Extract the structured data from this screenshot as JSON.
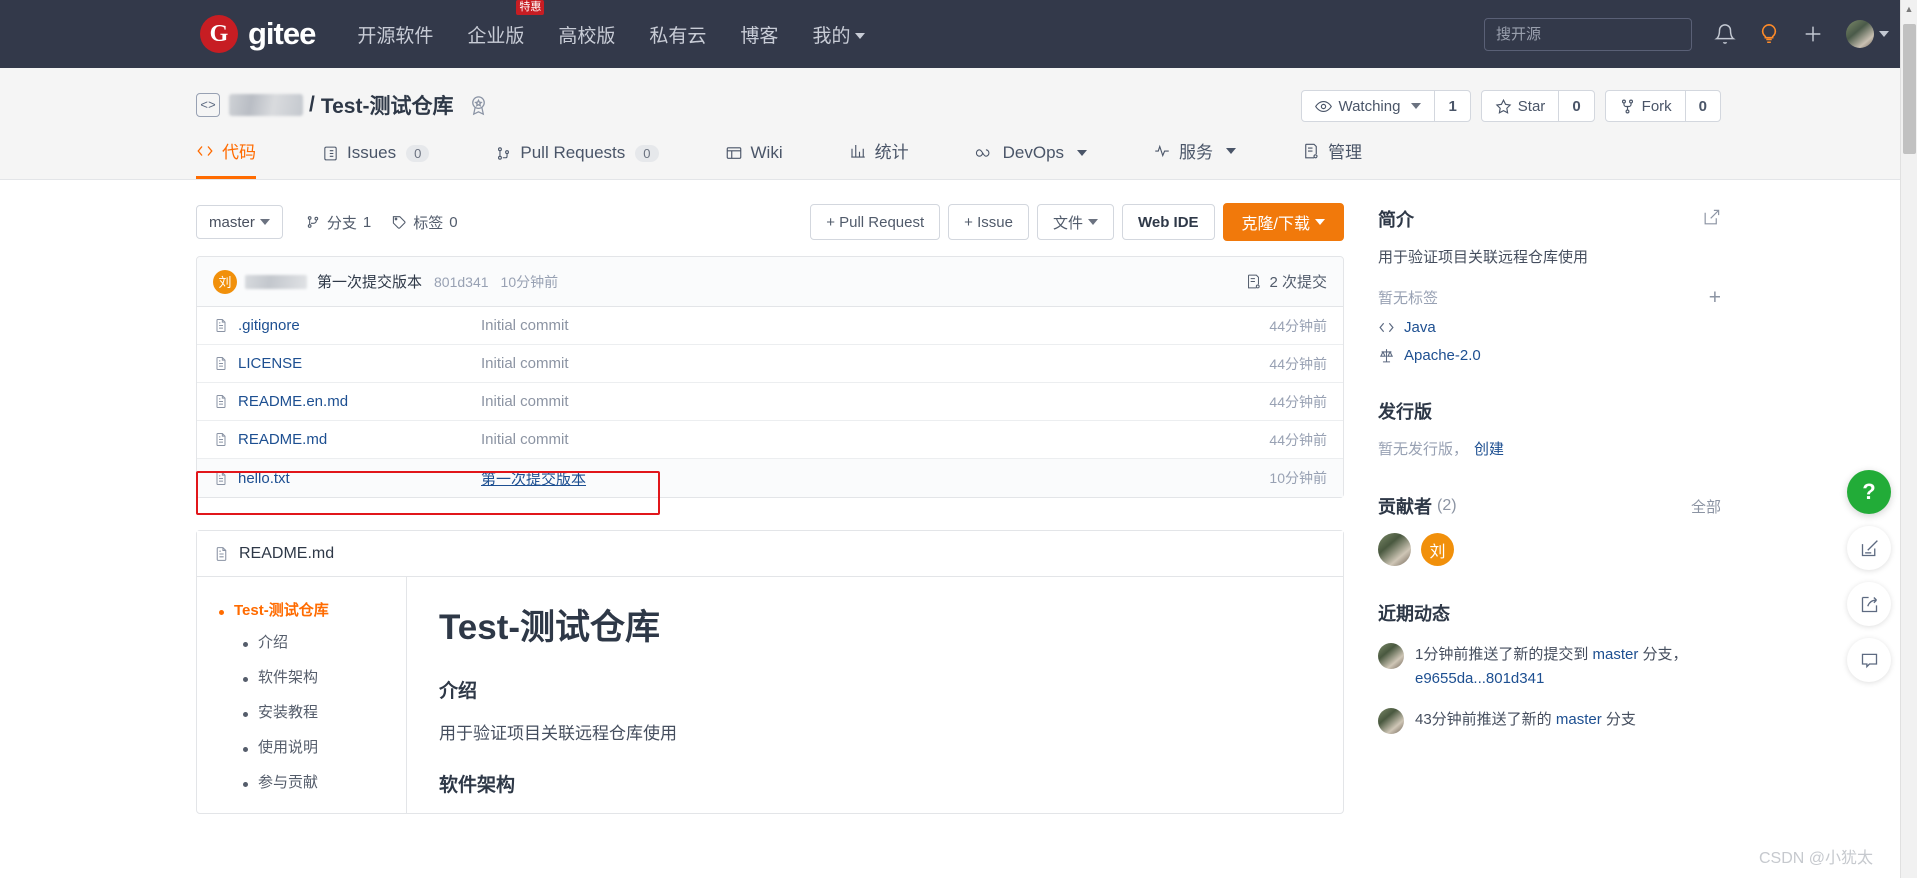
{
  "topnav": {
    "brand": "gitee",
    "logo_letter": "G",
    "links": [
      {
        "label": "开源软件",
        "badge": null,
        "caret": false
      },
      {
        "label": "企业版",
        "badge": "特惠",
        "caret": false
      },
      {
        "label": "高校版",
        "badge": null,
        "caret": false
      },
      {
        "label": "私有云",
        "badge": null,
        "caret": false
      },
      {
        "label": "博客",
        "badge": null,
        "caret": false
      },
      {
        "label": "我的",
        "badge": null,
        "caret": true
      }
    ],
    "search_placeholder": "搜开源",
    "icons": [
      "bell-icon",
      "lightbulb-icon",
      "plus-icon",
      "avatar"
    ]
  },
  "repo": {
    "owner_redacted": "",
    "separator": "/",
    "name": "Test-测试仓库",
    "watching_label": "Watching",
    "watching_count": "1",
    "star_label": "Star",
    "star_count": "0",
    "fork_label": "Fork",
    "fork_count": "0"
  },
  "tabs": [
    {
      "label": "代码",
      "count": null,
      "active": true,
      "icon": "code-icon"
    },
    {
      "label": "Issues",
      "count": "0",
      "active": false,
      "icon": "issue-icon"
    },
    {
      "label": "Pull Requests",
      "count": "0",
      "active": false,
      "icon": "pr-icon"
    },
    {
      "label": "Wiki",
      "count": null,
      "active": false,
      "icon": "wiki-icon"
    },
    {
      "label": "统计",
      "count": null,
      "active": false,
      "icon": "chart-icon"
    },
    {
      "label": "DevOps",
      "count": null,
      "active": false,
      "icon": "infinity-icon",
      "caret": true
    },
    {
      "label": "服务",
      "count": null,
      "active": false,
      "icon": "pulse-icon",
      "caret": true
    },
    {
      "label": "管理",
      "count": null,
      "active": false,
      "icon": "manage-icon"
    }
  ],
  "toolbar": {
    "branch": "master",
    "branches_label": "分支",
    "branches_count": "1",
    "tags_label": "标签",
    "tags_count": "0",
    "pull_request_btn": "+ Pull Request",
    "issue_btn": "+ Issue",
    "file_btn": "文件",
    "webide_btn": "Web IDE",
    "clone_btn": "克隆/下载"
  },
  "commit_bar": {
    "avatar_letter": "刘",
    "message": "第一次提交版本",
    "sha": "801d341",
    "time": "10分钟前",
    "commits_label": "2 次提交"
  },
  "files": [
    {
      "name": ".gitignore",
      "message": "Initial commit",
      "message_link": false,
      "time": "44分钟前",
      "highlight": false
    },
    {
      "name": "LICENSE",
      "message": "Initial commit",
      "message_link": false,
      "time": "44分钟前",
      "highlight": false
    },
    {
      "name": "README.en.md",
      "message": "Initial commit",
      "message_link": false,
      "time": "44分钟前",
      "highlight": false
    },
    {
      "name": "README.md",
      "message": "Initial commit",
      "message_link": false,
      "time": "44分钟前",
      "highlight": false
    },
    {
      "name": "hello.txt",
      "message": "第一次提交版本",
      "message_link": true,
      "time": "10分钟前",
      "highlight": true
    }
  ],
  "readme": {
    "filename": "README.md",
    "toc": [
      {
        "label": "Test-测试仓库",
        "level": 1
      },
      {
        "label": "介绍",
        "level": 2
      },
      {
        "label": "软件架构",
        "level": 2
      },
      {
        "label": "安装教程",
        "level": 2
      },
      {
        "label": "使用说明",
        "level": 2
      },
      {
        "label": "参与贡献",
        "level": 2
      }
    ],
    "h1": "Test-测试仓库",
    "section1_title": "介绍",
    "section1_text": "用于验证项目关联远程仓库使用",
    "section2_title": "软件架构"
  },
  "sidebar": {
    "intro_title": "简介",
    "intro_text": "用于验证项目关联远程仓库使用",
    "no_tags": "暂无标签",
    "language": "Java",
    "license": "Apache-2.0",
    "releases_title": "发行版",
    "no_releases": "暂无发行版，",
    "create_release": "创建",
    "contributors_title": "贡献者",
    "contributors_count": "(2)",
    "contributors_all": "全部",
    "contributor_letter": "刘",
    "activity_title": "近期动态",
    "activities": [
      {
        "text_before": "1分钟前推送了新的提交到 ",
        "link": "master",
        "text_mid": " 分支，",
        "link2": "e9655da...801d341",
        "text_after": ""
      },
      {
        "text_before": "43分钟前推送了新的 ",
        "link": "master",
        "text_mid": " 分支",
        "link2": "",
        "text_after": ""
      }
    ]
  },
  "float_buttons": [
    {
      "name": "help-button",
      "glyph": "?"
    },
    {
      "name": "feedback-button",
      "glyph": "edit-icon"
    },
    {
      "name": "share-button",
      "glyph": "share-icon"
    },
    {
      "name": "comment-button",
      "glyph": "comment-icon"
    }
  ],
  "watermark": "CSDN @小犹太"
}
